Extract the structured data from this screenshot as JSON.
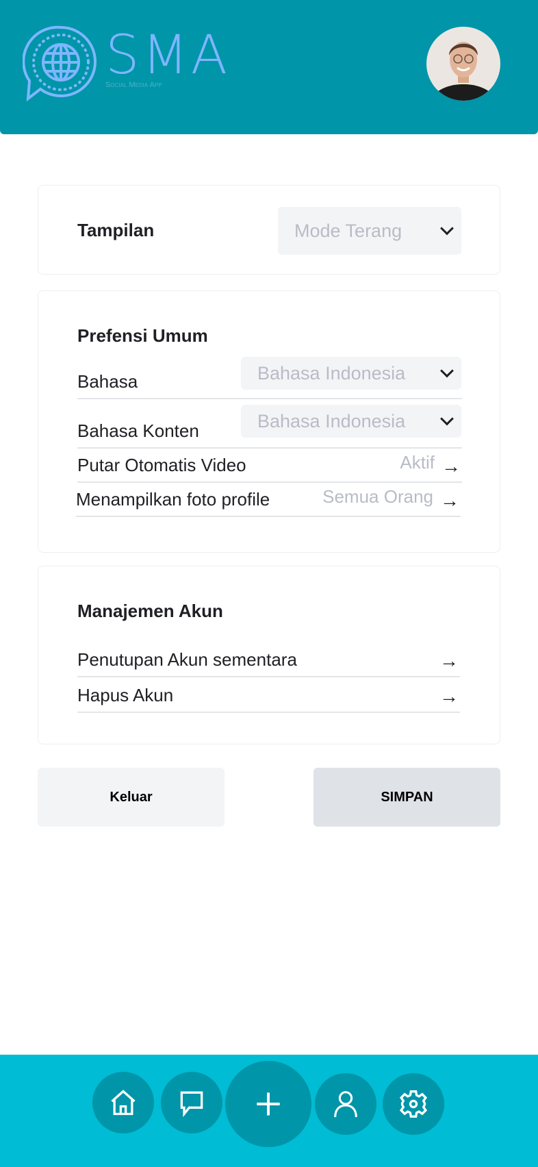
{
  "header": {
    "brand": "SMA",
    "brand_subtitle": "Social Media App"
  },
  "appearance": {
    "title": "Tampilan",
    "mode_value": "Mode Terang"
  },
  "general": {
    "title": "Prefensi Umum",
    "rows": [
      {
        "label": "Bahasa",
        "value": "Bahasa Indonesia"
      },
      {
        "label": "Bahasa Konten",
        "value": "Bahasa Indonesia"
      },
      {
        "label": "Putar Otomatis Video",
        "value": "Aktif"
      },
      {
        "label": "Menampilkan foto profile",
        "value": "Semua Orang"
      }
    ]
  },
  "account": {
    "title": "Manajemen Akun",
    "rows": [
      {
        "label": "Penutupan Akun sementara"
      },
      {
        "label": "Hapus Akun"
      }
    ]
  },
  "actions": {
    "logout": "Keluar",
    "save": "SIMPAN"
  },
  "nav": {
    "items": [
      "home-icon",
      "chat-icon",
      "plus-icon",
      "user-icon",
      "gear-icon"
    ]
  },
  "colors": {
    "header": "#0095a8",
    "nav": "#00bcd4",
    "logo": "#7eb6ff"
  }
}
